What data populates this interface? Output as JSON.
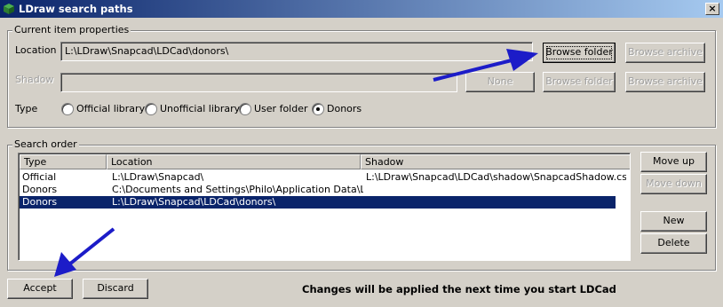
{
  "window": {
    "title": "LDraw search paths",
    "close_glyph": "×"
  },
  "current_item": {
    "group_title": "Current item properties",
    "location_label": "Location",
    "location_value": "L:\\LDraw\\Snapcad\\LDCad\\donors\\",
    "browse_folder_label": "Browse folder",
    "browse_archive_label": "Browse archive",
    "shadow_label": "Shadow",
    "shadow_value": "",
    "none_label": "None",
    "shadow_browse_folder_label": "Browse folder",
    "shadow_browse_archive_label": "Browse archive",
    "type_label": "Type",
    "type_options": [
      "Official library",
      "Unofficial library",
      "User folder",
      "Donors"
    ],
    "type_selected": "Donors"
  },
  "search_order": {
    "group_title": "Search order",
    "columns": [
      "Type",
      "Location",
      "Shadow"
    ],
    "rows": [
      {
        "type": "Official",
        "location": "L:\\LDraw\\Snapcad\\",
        "shadow": "L:\\LDraw\\Snapcad\\LDCad\\shadow\\SnapcadShadow.csl"
      },
      {
        "type": "Donors",
        "location": "C:\\Documents and Settings\\Philo\\Application Data\\LDC...",
        "shadow": ""
      },
      {
        "type": "Donors",
        "location": "L:\\LDraw\\Snapcad\\LDCad\\donors\\",
        "shadow": ""
      }
    ],
    "selected_row": 2,
    "move_up_label": "Move up",
    "move_down_label": "Move down",
    "new_label": "New",
    "delete_label": "Delete"
  },
  "footer": {
    "accept_label": "Accept",
    "discard_label": "Discard",
    "status_text": "Changes will be applied the next time you start LDCad"
  },
  "colors": {
    "title_bar": "#0a246a",
    "selection": "#0a246a",
    "annotation_arrow": "#1c1cc8",
    "face": "#d4d0c8"
  },
  "icons": [
    "app-icon",
    "close-icon",
    "annotation-arrow-icon"
  ]
}
